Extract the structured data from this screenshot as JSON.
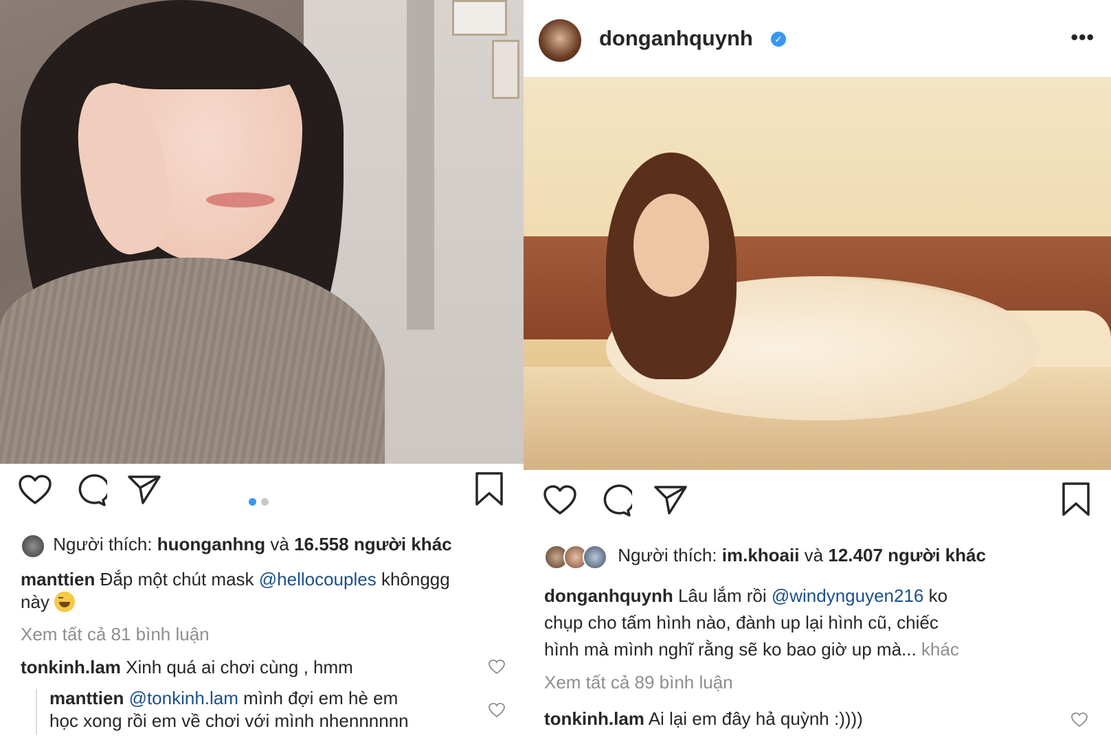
{
  "left_post": {
    "likes": {
      "prefix": "Người thích: ",
      "user": "huonganhng",
      "joiner": " và ",
      "count": "16.558 người khác"
    },
    "caption": {
      "user": "manttien",
      "text_before": " Đắp một chút mask ",
      "mention": "@hellocouples",
      "text_after": " khônggg",
      "text_line2": "này "
    },
    "view_all": "Xem tất cả 81 bình luận",
    "comments": [
      {
        "user": "tonkinh.lam",
        "text": " Xinh quá ai chơi cùng , hmm"
      }
    ],
    "reply": {
      "user": "manttien",
      "mention": " @tonkinh.lam",
      "text_line1": " mình đợi em hè em",
      "text_line2": "học xong rồi em về chơi với mình nhennnnnn"
    },
    "carousel": {
      "pages": 2,
      "current": 1
    },
    "colors": {
      "active_dot": "#3897f0",
      "inactive_dot": "#c7c7c7"
    }
  },
  "right_post": {
    "header": {
      "username": "donganhquynh",
      "verified_icon": "✓",
      "more": "•••"
    },
    "likes": {
      "prefix": "Người thích: ",
      "user": "im.khoaii",
      "joiner": " và ",
      "count": "12.407 người khác"
    },
    "caption": {
      "user": "donganhquynh",
      "text_before": " Lâu lắm rồi ",
      "mention": "@windynguyen216",
      "text_after": " ko",
      "line2": "chụp cho tấm hình nào, đành up lại hình cũ, chiếc",
      "line3": "hình mà mình nghĩ rằng sẽ ko bao giờ up mà... ",
      "more": "khác"
    },
    "view_all": "Xem tất cả 89 bình luận",
    "comments": [
      {
        "user": "tonkinh.lam",
        "text": " Ai lại em đây hả quỳnh :))))"
      }
    ]
  },
  "icons": {
    "like": "heart-icon",
    "comment": "comment-bubble-icon",
    "share": "paper-plane-icon",
    "save": "bookmark-icon",
    "verified": "verified-badge-icon",
    "more": "more-options-icon"
  }
}
